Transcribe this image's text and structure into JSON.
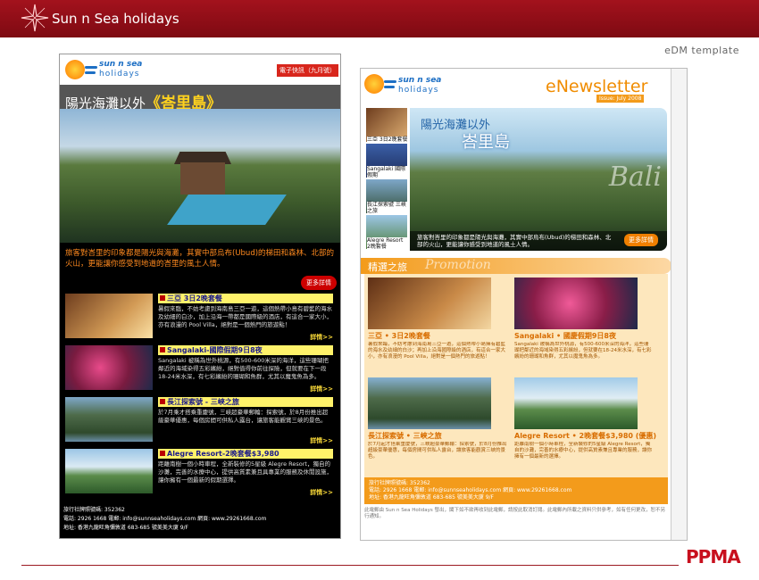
{
  "header": {
    "title": "Sun n Sea holidays",
    "subtitle": "eDM template"
  },
  "brand": {
    "line1": "sun n sea",
    "line2": "holidays",
    "logo": "PPMA"
  },
  "left": {
    "badge": "電子快訊（九月號）",
    "headline_prefix": "陽光海灘以外",
    "headline": "《峇里島》",
    "intro": "旅客對峇里的印象都是陽光與海灘，其實中部烏布(Ubud)的梯田和森林、北部的火山，更能讓你感受到地道的峇里的風土人情。",
    "more_btn": "更多詳情",
    "items": [
      {
        "title": "三亞 3日2晚套餐",
        "body": "暑假來臨，不妨考慮到海南島三亞一遊，這個熱帶小島有碧藍的海水及幼細的白沙，加上沿海一帶都是國際級的酒店，有這合一家大小，亦有浪漫的 Pool Villa，絕對是一個熱門的旅遊點！",
        "more": "詳情>>"
      },
      {
        "title": "Sangalaki-國際假期9日8夜",
        "body": "Sangalaki 被稱為世外桃源，有500-600米深的海洋，這些珊瑚把鄰近的海域染得五彩繽紛，絕對值得你前往探險，但就要在下一段18-24米水深，有七彩繽紛的珊瑚和魚群，尤其以魔鬼魚為多。",
        "more": "詳情>>"
      },
      {
        "title": "長江探索號 - 三峽之旅",
        "body": "於7月乘才搭乘重慶號，三峽超豪華郵輪：探索號，於8月份推出超級豪華優惠，每個房間可供私人露台，讓旅客能觀賞三峽的景色。",
        "more": "詳情>>"
      },
      {
        "title": "Alegre Resort-2晚套餐$3,980",
        "body": "距離南樹一個小時車程，全新裝修的5星級 Alegre Resort，獨自的沙灘，完善的水療中心，提供高質素兼且具專業的服務及休閒設施，讓你擁有一個最新的假期選擇。",
        "more": "詳情>>"
      }
    ],
    "footer": [
      "旅行社牌照號碼: 352362",
      "電話: 2926 1668    電郵: info@sunnseaholidays.com    網頁: www.29261668.com",
      "地址: 香港九龍旺角彌敦道 683-685 號美美大廈 9/F"
    ]
  },
  "right": {
    "title": "eNewsletter",
    "issue": "Issue: July 2008",
    "hero_line1": "陽光海灘以外",
    "hero_line2": "峇里島",
    "hero_watermark": "Bali",
    "hero_caption": "旅客對峇里的印象都是陽光與海灘，其實中部烏布(Ubud)的梯田和森林、北部的火山，更能讓你感受到地道的風土人情。",
    "hero_btn": "更多詳情",
    "sidebar": [
      "三亞 3日2晚套餐",
      "Sangalaki 國際假期",
      "長江探索號 三峽之旅",
      "Alegre Resort 2晚套餐"
    ],
    "promo_title": "精選之旅",
    "promo_watermark": "Promotion",
    "cards": [
      {
        "title": "三亞 • 3日2晚套餐",
        "body": "暑假來臨，不妨考慮到海南島三亞一遊，這個熱帶小島擁有碧藍的海水及幼細的白沙；再加上沿海國際級的酒店，有這合一家大小，亦有浪漫的 Pool Villa，絕對是一個熱門的旅遊點！"
      },
      {
        "title": "Sangalaki • 國慶假期9日8夜",
        "body": "Sangalaki 被稱為世外桃源，有500-600米深的海洋，這些珊瑚把鄰近的海域染得五彩繽紛，但就要在18-24米水深，有七彩繽紛的珊瑚和魚群，尤其以魔鬼魚為多。"
      },
      {
        "title": "長江探索號 • 三峽之旅",
        "body": "於7月起才搭乘重慶號，三峽超豪華郵輪：探索號，於8月份推出超級豪華優惠，每個房間可供私人露台，讓旅客能觀賞三峽的景色。"
      },
      {
        "title": "Alegre Resort • 2晚套餐$3,980 (優惠)",
        "body": "距離南樹一個小時車程，全新裝修的5星級 Alegre Resort，獨自的沙灘，完善的水療中心，提供高質素兼且專業的服務，讓你擁有一個最新的選擇。"
      }
    ],
    "footer": [
      "旅行社牌照號碼: 352362",
      "電話: 2926 1668    電郵: info@sunnseaholidays.com    網頁: www.29261668.com",
      "地址: 香港九龍旺角彌敦道 683-685 號美美大廈 9/F"
    ],
    "disclaimer": "此電郵由 Sun n Sea Holidays 發出，閣下如不欲再收到此電郵，請按此取消訂閱。此電郵內所載之資料只供參考，如有任何更改，恕不另行通知。"
  }
}
